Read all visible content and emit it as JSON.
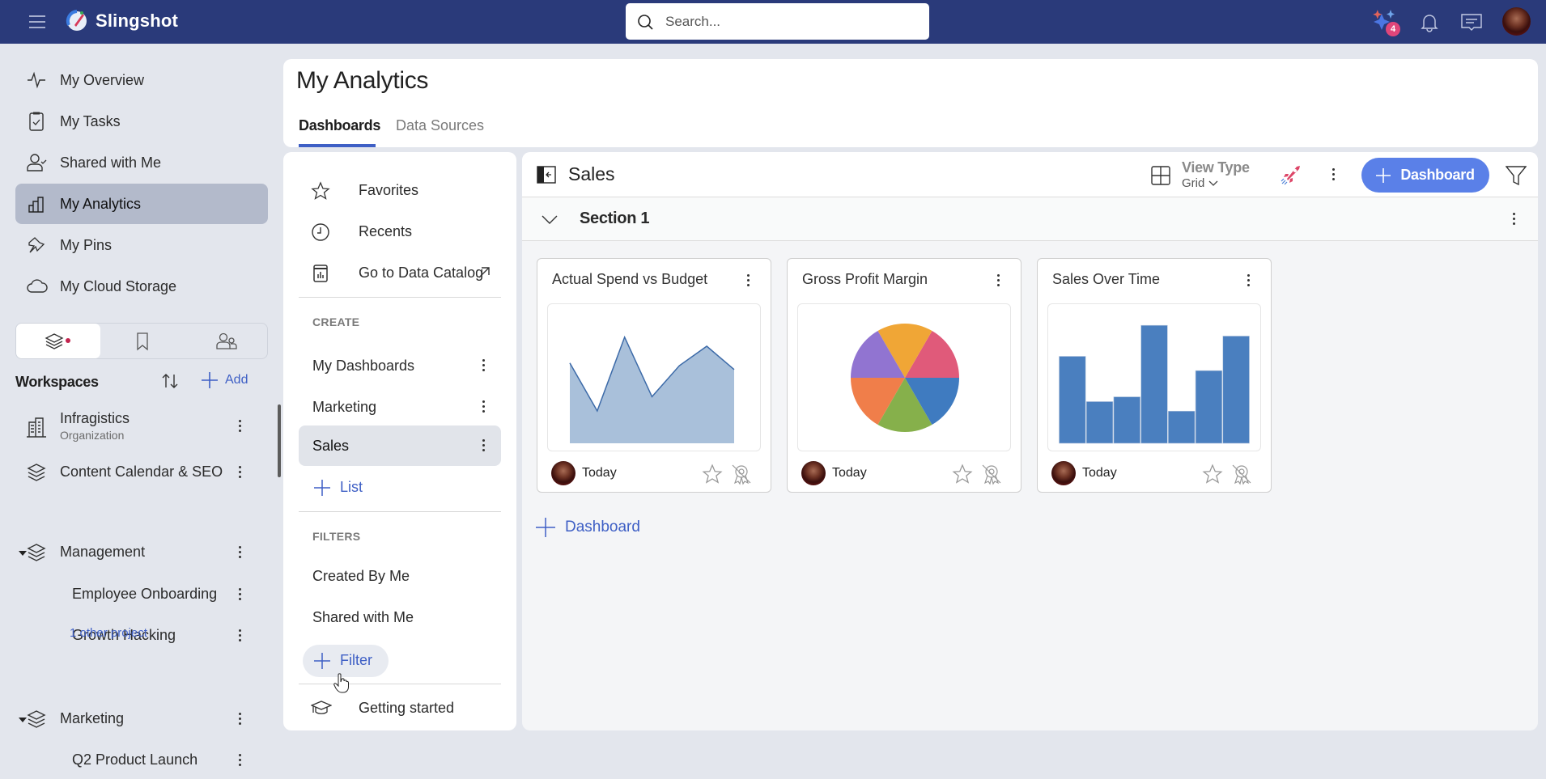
{
  "app": {
    "name": "Slingshot"
  },
  "search": {
    "placeholder": "Search..."
  },
  "topbar": {
    "ai_badge_count": "4",
    "icons": [
      "ai-sparkle-icon",
      "bell-icon",
      "chat-icon",
      "user-avatar"
    ]
  },
  "sidebar": {
    "nav": [
      {
        "label": "My Overview",
        "icon": "pulse-icon"
      },
      {
        "label": "My Tasks",
        "icon": "clipboard-check-icon"
      },
      {
        "label": "Shared with Me",
        "icon": "user-check-icon"
      },
      {
        "label": "My Analytics",
        "icon": "bar-chart-icon",
        "active": true
      },
      {
        "label": "My Pins",
        "icon": "pin-icon"
      },
      {
        "label": "My Cloud Storage",
        "icon": "cloud-icon"
      }
    ],
    "segments": [
      "workspaces-icon",
      "bookmark-icon",
      "people-icon"
    ],
    "workspaces_title": "Workspaces",
    "add_label": "Add",
    "workspaces": [
      {
        "label": "Infragistics",
        "sublabel": "Organization",
        "icon": "building-icon"
      },
      {
        "label": "Content Calendar & SEO",
        "icon": "layers-icon"
      },
      {
        "label": "Management",
        "icon": "layers-icon",
        "expanded": true,
        "children": [
          "Employee Onboarding",
          "Growth Hacking"
        ],
        "more": "1 other project"
      },
      {
        "label": "Marketing",
        "icon": "layers-icon",
        "expanded": true,
        "children": [
          "Q2 Product Launch"
        ]
      }
    ]
  },
  "header": {
    "title": "My Analytics",
    "tabs": [
      {
        "label": "Dashboards",
        "active": true
      },
      {
        "label": "Data Sources"
      }
    ]
  },
  "middle": {
    "top_items": [
      "Favorites",
      "Recents",
      "Go to Data Catalog"
    ],
    "create_title": "CREATE",
    "create_items": [
      "My Dashboards",
      "Marketing",
      "Sales"
    ],
    "active_item": "Sales",
    "add_list": "List",
    "filters_title": "FILTERS",
    "filter_items": [
      "Created By Me",
      "Shared with Me"
    ],
    "add_filter": "Filter",
    "getting_started": "Getting started"
  },
  "main": {
    "title": "Sales",
    "view_type_label": "View Type",
    "view_type_value": "Grid",
    "dashboard_button": "Dashboard",
    "section_title": "Section 1",
    "add_dashboard": "Dashboard",
    "cards": [
      {
        "title": "Actual Spend vs Budget",
        "updated": "Today",
        "chart": "area"
      },
      {
        "title": "Gross Profit Margin",
        "updated": "Today",
        "chart": "pie"
      },
      {
        "title": "Sales Over Time",
        "updated": "Today",
        "chart": "bar"
      }
    ]
  },
  "chart_data": [
    {
      "type": "area",
      "title": "Actual Spend vs Budget",
      "values": [
        62,
        25,
        82,
        36,
        60,
        75,
        57
      ],
      "ylim": [
        0,
        100
      ],
      "color": "#a9c0da",
      "line_color": "#3c6aa8"
    },
    {
      "type": "pie",
      "title": "Gross Profit Margin",
      "values": [
        1,
        1,
        1,
        1,
        1,
        1
      ],
      "colors": [
        "#e05a7a",
        "#f0a636",
        "#9174d1",
        "#f07e4a",
        "#86b04b",
        "#3f7bc0"
      ]
    },
    {
      "type": "bar",
      "title": "Sales Over Time",
      "values": [
        73,
        35,
        39,
        99,
        27,
        61,
        90
      ],
      "ylim": [
        0,
        110
      ],
      "color": "#4a7fbf"
    }
  ],
  "colors": {
    "topbar": "#2a3a7a",
    "accent": "#3e5fc5",
    "primary_button": "#5a80e8"
  }
}
